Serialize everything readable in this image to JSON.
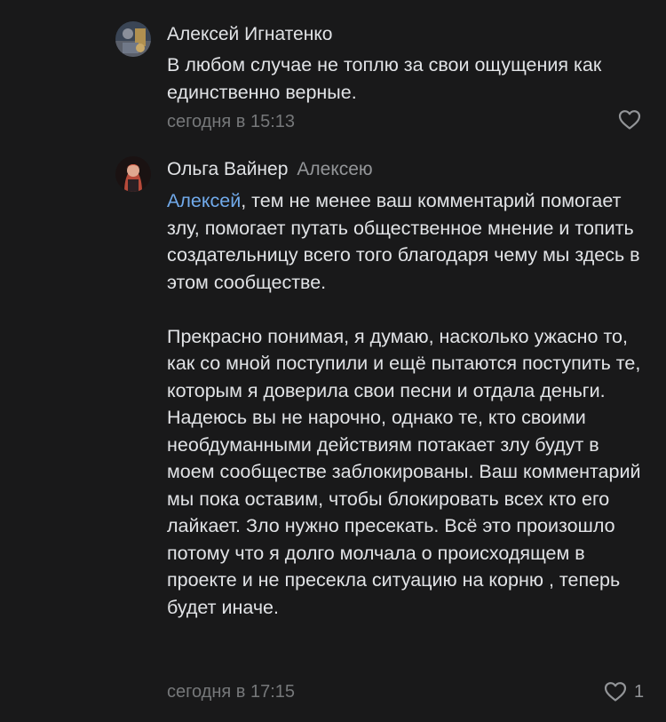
{
  "comments": [
    {
      "author": "Алексей Игнатенко",
      "reply_to": "",
      "text": "В любом случае не топлю за свои ощущения как единственно верные.",
      "timestamp": "сегодня в 15:13",
      "likes": "",
      "avatar_icon": "avatar-photo"
    },
    {
      "author": "Ольга Вайнер",
      "reply_to": "Алексею",
      "mention": "Алексей",
      "text_p1_rest": ", тем не менее ваш комментарий помогает злу, помогает путать общественное мнение и топить создательницу всего того благодаря чему мы здесь в этом сообществе.",
      "text_p2": "Прекрасно понимая, я думаю, насколько ужасно то, как со мной поступили и ещё пытаются поступить те, которым я доверила свои песни и отдала деньги. Надеюсь вы не нарочно, однако те, кто своими необдуманными действиям потакает злу будут в моем сообществе заблокированы. Ваш комментарий мы пока оставим, чтобы блокировать всех кто его лайкает. Зло нужно пресекать. Всё это произошло потому что я долго молчала о происходящем в проекте и не пресекла ситуацию на корню , теперь будет иначе.",
      "timestamp": "сегодня в 17:15",
      "likes": "1",
      "avatar_icon": "avatar-photo"
    }
  ],
  "colors": {
    "background": "#19191a",
    "text": "#e1e3e6",
    "secondary": "#939598",
    "timestamp": "#76787a",
    "link": "#71aaeb"
  }
}
